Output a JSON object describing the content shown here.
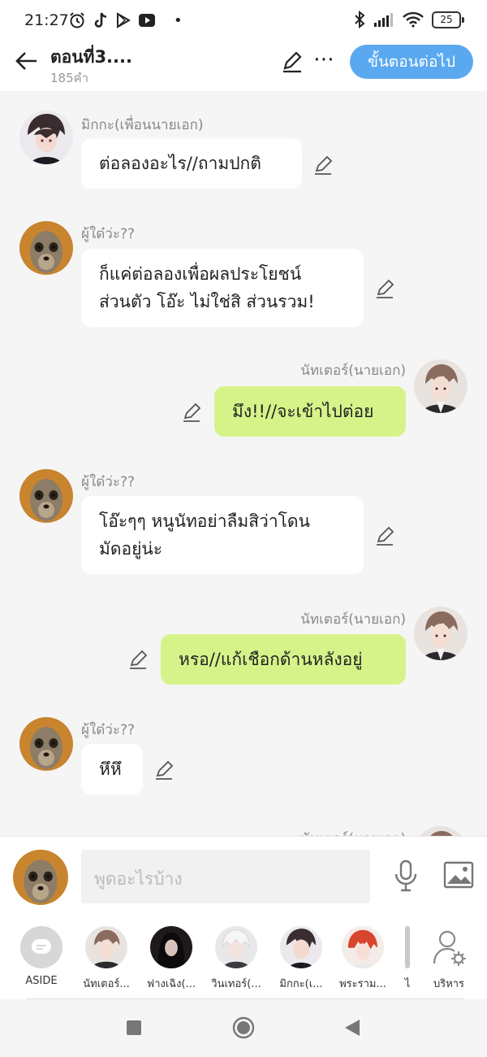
{
  "status_bar": {
    "time": "21:27",
    "battery": "25"
  },
  "header": {
    "title": "ตอนที่3....",
    "word_count": "185คำ",
    "next_button": "ขั้นตอนต่อไป"
  },
  "messages": [
    {
      "side": "left",
      "name": "มิกกะ(เพื่อนนายเอก)",
      "lines": [
        "ต่อลองอะไร//ถามปกติ"
      ]
    },
    {
      "side": "left",
      "name": "ผู้ใด๋ว่ะ??",
      "lines": [
        "ก็แค่ต่อลองเพื่อผลประโยชน์",
        "ส่วนตัว โอ๊ะ ไม่ใช่สิ ส่วนรวม!"
      ]
    },
    {
      "side": "right",
      "name": "นัทเตอร์(นายเอก)",
      "lines": [
        "มึง!!//จะเข้าไปต่อย"
      ]
    },
    {
      "side": "left",
      "name": "ผู้ใด๋ว่ะ??",
      "lines": [
        "โอ๊ะๆๆ หนูนัทอย่าลืมสิว่าโดน",
        "มัดอยู่น่ะ"
      ]
    },
    {
      "side": "right",
      "name": "นัทเตอร์(นายเอก)",
      "lines": [
        "หรอ//แก้เชือกด้านหลังอยู่"
      ]
    },
    {
      "side": "left",
      "name": "ผู้ใด๋ว่ะ??",
      "lines": [
        "หึหึ"
      ]
    },
    {
      "side": "right",
      "name": "นัทเตอร์(นายเอก)",
      "lines": []
    }
  ],
  "input": {
    "placeholder": "พูดอะไรบ้าง"
  },
  "characters": [
    {
      "label": "ASIDE",
      "icon": "aside-chat-icon"
    },
    {
      "label": "นัทเตอร์...",
      "icon": "avatar"
    },
    {
      "label": "ฟางเฉิง(...",
      "icon": "avatar"
    },
    {
      "label": "วินเทอร์(...",
      "icon": "avatar"
    },
    {
      "label": "มิกกะ(เ...",
      "icon": "avatar"
    },
    {
      "label": "พระราม...",
      "icon": "avatar"
    },
    {
      "label": "ไ",
      "icon": "avatar"
    },
    {
      "label": "บริหาร",
      "icon": "manage-user-icon"
    }
  ],
  "colors": {
    "accent": "#5aa8f0",
    "right_bubble": "#d6f38a",
    "left_bubble": "#ffffff",
    "background": "#f5f5f5"
  }
}
